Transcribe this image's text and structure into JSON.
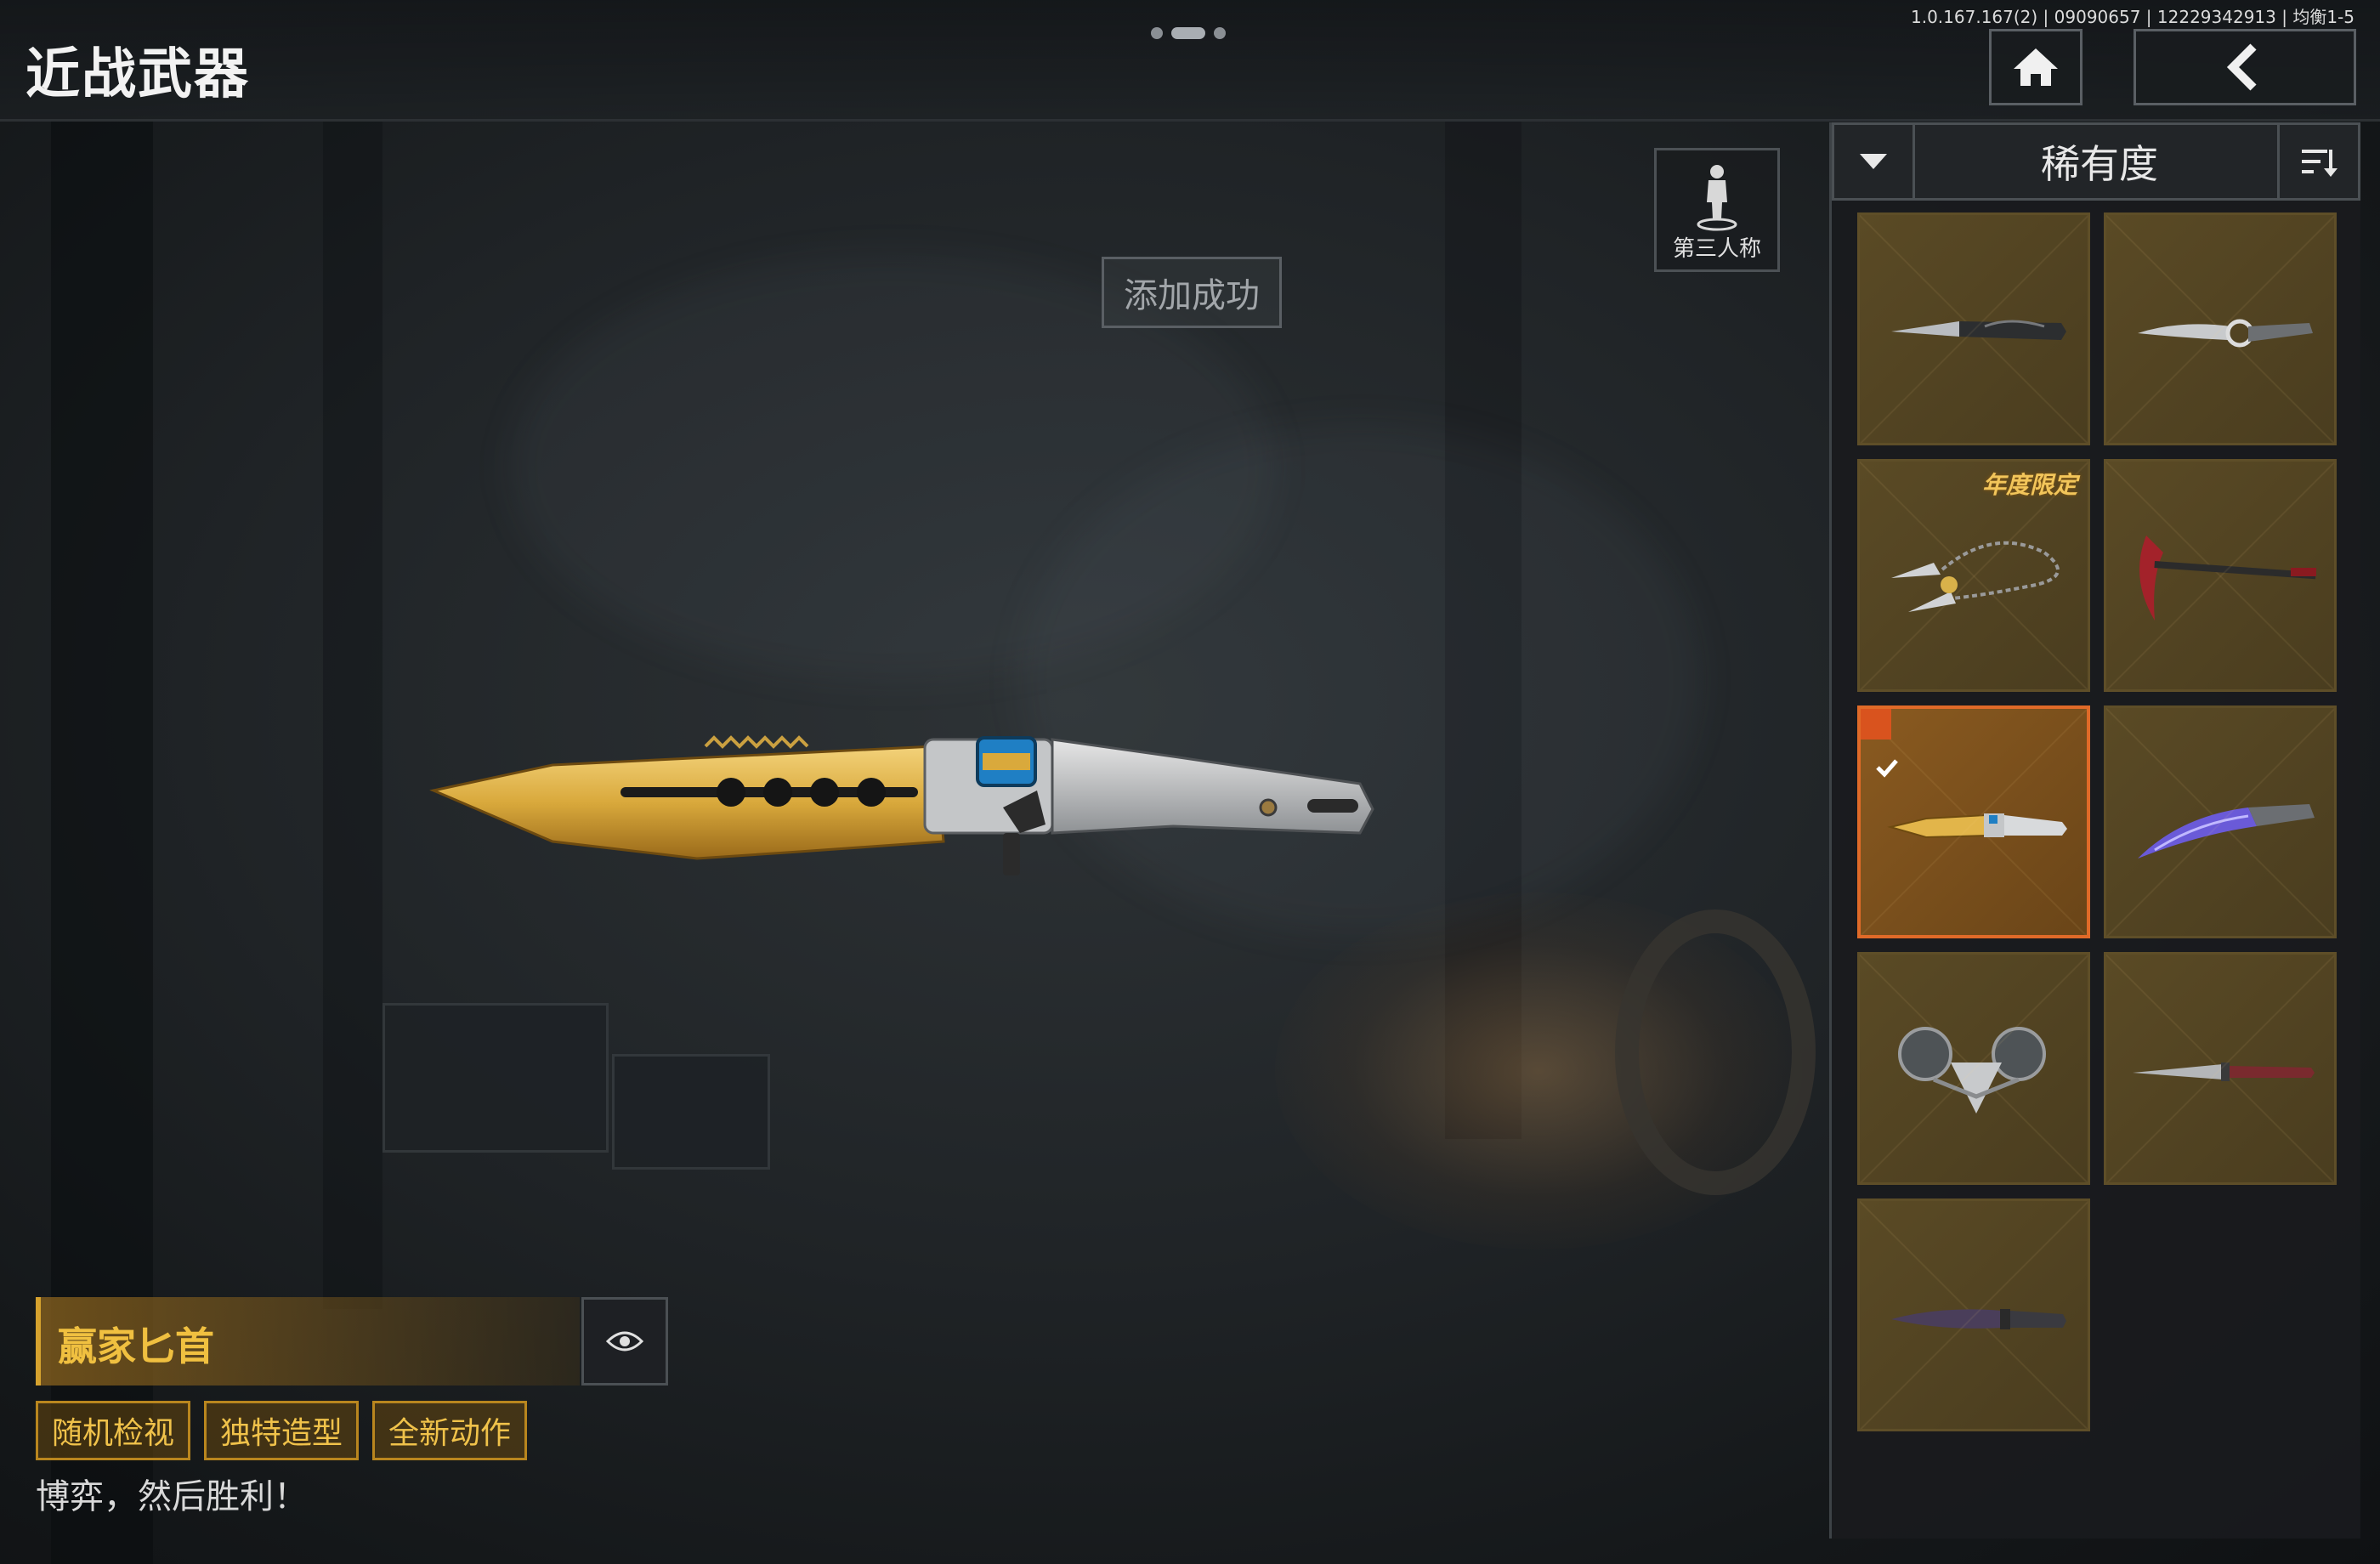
{
  "header": {
    "title": "近战武器",
    "build_info": "1.0.167.167(2) | 09090657 | 12229342913 | 均衡1-5"
  },
  "view_toggle": {
    "label": "第三人称"
  },
  "toast": {
    "text": "添加成功"
  },
  "sort": {
    "label": "稀有度"
  },
  "item": {
    "name": "赢家匕首",
    "tags": [
      "随机检视",
      "独特造型",
      "全新动作"
    ],
    "description": "博弈，然后胜利！"
  },
  "grid": {
    "items": [
      {
        "weapon": "dark-dagger",
        "selected": false
      },
      {
        "weapon": "silver-karambit",
        "selected": false
      },
      {
        "weapon": "chain-blades",
        "selected": false,
        "badge": "年度限定"
      },
      {
        "weapon": "red-scythe",
        "selected": false
      },
      {
        "weapon": "gold-dagger",
        "selected": true
      },
      {
        "weapon": "purple-machete",
        "selected": false
      },
      {
        "weapon": "claw-blades",
        "selected": false
      },
      {
        "weapon": "red-dagger",
        "selected": false
      },
      {
        "weapon": "purple-kukri",
        "selected": false
      }
    ]
  },
  "colors": {
    "accent": "#e06a28",
    "gold": "#f0c040",
    "cell_bg": "#5a4a25"
  }
}
